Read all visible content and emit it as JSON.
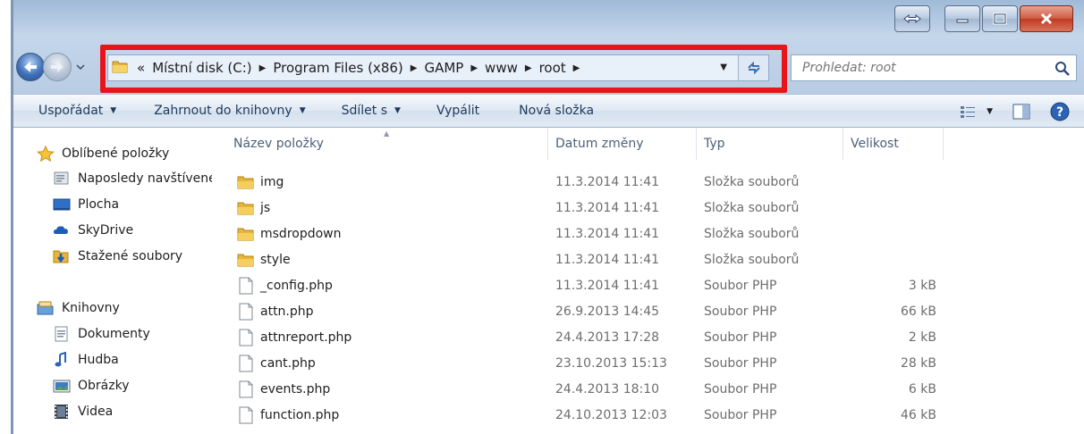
{
  "window": {
    "caption_buttons": [
      "snap",
      "minimize",
      "maximize",
      "close"
    ]
  },
  "address": {
    "overflow": "«",
    "segments": [
      "Místní disk (C:)",
      "Program Files (x86)",
      "GAMP",
      "www",
      "root"
    ],
    "highlight_color": "#e8141c"
  },
  "search": {
    "placeholder": "Prohledat: root"
  },
  "toolbar": {
    "organize": "Uspořádat",
    "include_library": "Zahrnout do knihovny",
    "share": "Sdílet s",
    "burn": "Vypálit",
    "new_folder": "Nová složka"
  },
  "navpane": {
    "favorites": "Oblíbené položky",
    "recent": "Naposledy navštívené",
    "desktop": "Plocha",
    "skydrive": "SkyDrive",
    "downloads": "Stažené soubory",
    "libraries": "Knihovny",
    "documents": "Dokumenty",
    "music": "Hudba",
    "pictures": "Obrázky",
    "videos": "Videa"
  },
  "columns": {
    "name": "Název položky",
    "date": "Datum změny",
    "type": "Typ",
    "size": "Velikost"
  },
  "files": [
    {
      "name": "img",
      "date": "11.3.2014 11:41",
      "type": "Složka souborů",
      "size": "",
      "kind": "folder"
    },
    {
      "name": "js",
      "date": "11.3.2014 11:41",
      "type": "Složka souborů",
      "size": "",
      "kind": "folder"
    },
    {
      "name": "msdropdown",
      "date": "11.3.2014 11:41",
      "type": "Složka souborů",
      "size": "",
      "kind": "folder"
    },
    {
      "name": "style",
      "date": "11.3.2014 11:41",
      "type": "Složka souborů",
      "size": "",
      "kind": "folder"
    },
    {
      "name": "_config.php",
      "date": "11.3.2014 11:41",
      "type": "Soubor PHP",
      "size": "3 kB",
      "kind": "file"
    },
    {
      "name": "attn.php",
      "date": "26.9.2013 14:45",
      "type": "Soubor PHP",
      "size": "66 kB",
      "kind": "file"
    },
    {
      "name": "attnreport.php",
      "date": "24.4.2013 17:28",
      "type": "Soubor PHP",
      "size": "2 kB",
      "kind": "file"
    },
    {
      "name": "cant.php",
      "date": "23.10.2013 15:13",
      "type": "Soubor PHP",
      "size": "28 kB",
      "kind": "file"
    },
    {
      "name": "events.php",
      "date": "24.4.2013 18:10",
      "type": "Soubor PHP",
      "size": "6 kB",
      "kind": "file"
    },
    {
      "name": "function.php",
      "date": "24.10.2013 12:03",
      "type": "Soubor PHP",
      "size": "46 kB",
      "kind": "file"
    }
  ]
}
